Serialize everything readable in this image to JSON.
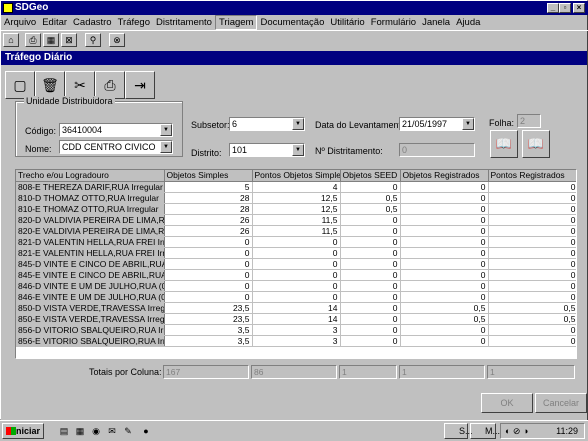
{
  "window": {
    "title": "SDGeo"
  },
  "menu": [
    "Arquivo",
    "Editar",
    "Cadastro",
    "Tráfego",
    "Distritamento",
    "Triagem",
    "Documentação",
    "Utilitário",
    "Formulário",
    "Janela",
    "Ajuda"
  ],
  "menu_active": "Triagem",
  "toolbar_icons": [
    "folder-icon",
    "print-icon",
    "layout-icon",
    "map-icon",
    "find-icon",
    "grid-icon"
  ],
  "child": {
    "title": "Tráfego Diário",
    "buttons": [
      {
        "name": "new-doc-button",
        "glyph": "▢"
      },
      {
        "name": "delete-button",
        "glyph": "🗑"
      },
      {
        "name": "tools-button",
        "glyph": "✂"
      },
      {
        "name": "print-button",
        "glyph": "⎙"
      },
      {
        "name": "exit-button",
        "glyph": "⇥"
      }
    ]
  },
  "form": {
    "group_label": "Unidade Distribuidora",
    "codigo_label": "Código:",
    "codigo_value": "36410004",
    "nome_label": "Nome:",
    "nome_value": "CDD CENTRO CIVICO",
    "subsetor_label": "Subsetor:",
    "subsetor_value": "6",
    "distrito_label": "Distrito:",
    "distrito_value": "101",
    "data_label": "Data do Levantamento:",
    "data_value": "21/05/1997",
    "numdist_label": "Nº Distritamento:",
    "numdist_value": "0",
    "folha_label": "Folha:",
    "folha_value": "2"
  },
  "grid": {
    "columns": [
      "Trecho e/ou Logradouro",
      "Objetos Simples",
      "Pontos Objetos Simples",
      "Objetos SEED",
      "Objetos Registrados",
      "Pontos Registrados"
    ],
    "rows": [
      [
        "808-E THEREZA DARIF,RUA  Irregular",
        "5",
        "4",
        "0",
        "0",
        "0"
      ],
      [
        "810-D THOMAZ OTTO,RUA  Irregular",
        "28",
        "12,5",
        "0,5",
        "0",
        "0"
      ],
      [
        "810-E THOMAZ OTTO,RUA  Irregular",
        "28",
        "12,5",
        "0,5",
        "0",
        "0"
      ],
      [
        "820-D VALDIVIA PEREIRA DE LIMA,RUA",
        "26",
        "11,5",
        "0",
        "0",
        "0"
      ],
      [
        "820-E VALDIVIA PEREIRA DE LIMA,RUA",
        "26",
        "11,5",
        "0",
        "0",
        "0"
      ],
      [
        "821-D VALENTIN HELLA,RUA FREI Irreg",
        "0",
        "0",
        "0",
        "0",
        "0"
      ],
      [
        "821-E VALENTIN HELLA,RUA FREI Irreg",
        "0",
        "0",
        "0",
        "0",
        "0"
      ],
      [
        "845-D VINTE E CINCO DE ABRIL,RUA",
        "0",
        "0",
        "0",
        "0",
        "0"
      ],
      [
        "845-E VINTE E CINCO DE ABRIL,RUA",
        "0",
        "0",
        "0",
        "0",
        "0"
      ],
      [
        "846-D VINTE E UM DE JULHO,RUA (0-",
        "0",
        "0",
        "0",
        "0",
        "0"
      ],
      [
        "846-E VINTE E UM DE JULHO,RUA (0-",
        "0",
        "0",
        "0",
        "0",
        "0"
      ],
      [
        "850-D VISTA VERDE,TRAVESSA  Irregu",
        "23,5",
        "14",
        "0",
        "0,5",
        "0,5"
      ],
      [
        "850-E VISTA VERDE,TRAVESSA  Irregu",
        "23,5",
        "14",
        "0",
        "0,5",
        "0,5"
      ],
      [
        "856-D VITORIO SBALQUEIRO,RUA  Irre",
        "3,5",
        "3",
        "0",
        "0",
        "0"
      ],
      [
        "856-E VITORIO SBALQUEIRO,RUA  Irre",
        "3,5",
        "3",
        "0",
        "0",
        "0"
      ]
    ]
  },
  "totals": {
    "label": "Totais por Coluna:",
    "values": [
      "167",
      "86",
      "1",
      "1",
      "1"
    ]
  },
  "buttons": {
    "ok": "OK",
    "cancel": "Cancelar"
  },
  "taskbar": {
    "start": "Iniciar",
    "tasks": [
      "S...",
      "M..."
    ],
    "clock": "11:29"
  }
}
